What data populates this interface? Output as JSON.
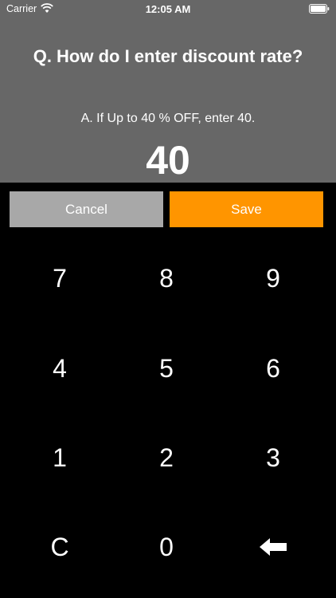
{
  "status_bar": {
    "carrier": "Carrier",
    "time": "12:05 AM"
  },
  "help": {
    "question": "Q. How do I enter discount rate?",
    "answer": "A. If Up to 40 % OFF, enter 40."
  },
  "display": {
    "value": "40"
  },
  "actions": {
    "cancel_label": "Cancel",
    "save_label": "Save"
  },
  "keypad": {
    "k7": "7",
    "k8": "8",
    "k9": "9",
    "k4": "4",
    "k5": "5",
    "k6": "6",
    "k1": "1",
    "k2": "2",
    "k3": "3",
    "clear": "C",
    "k0": "0",
    "backspace_icon": "left-arrow-icon"
  },
  "colors": {
    "header_bg": "#676767",
    "cancel_bg": "#a8a8a8",
    "save_bg": "#ff9500",
    "keypad_bg": "#000000"
  }
}
